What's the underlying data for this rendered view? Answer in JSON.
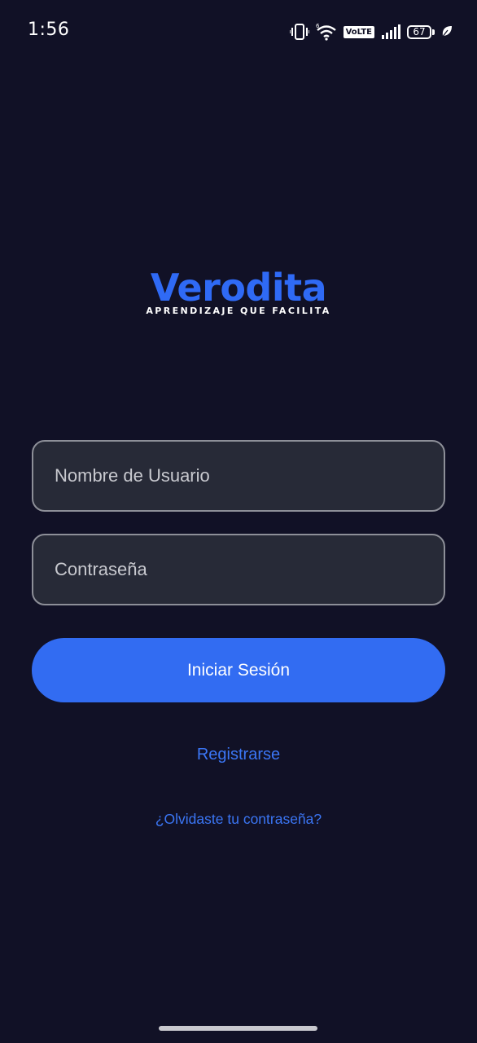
{
  "status_bar": {
    "time": "1:56",
    "icons": [
      "vibrate-icon",
      "wifi-6-icon",
      "volte-icon",
      "signal-icon",
      "battery-icon",
      "leaf-icon"
    ],
    "network_badge": "VoLTE",
    "battery_level": "67"
  },
  "logo": {
    "name": "Verodita",
    "tagline": "APRENDIZAJE QUE FACILITA",
    "color": "#2f6af5"
  },
  "form": {
    "username_placeholder": "Nombre de Usuario",
    "password_placeholder": "Contraseña",
    "login_label": "Iniciar Sesión"
  },
  "links": {
    "register": "Registrarse",
    "forgot_password": "¿Olvidaste tu contraseña?"
  },
  "colors": {
    "background": "#111126",
    "accent": "#326cf2",
    "field_background": "#272a37",
    "field_border": "#8d8f98",
    "link": "#3b76f5"
  }
}
